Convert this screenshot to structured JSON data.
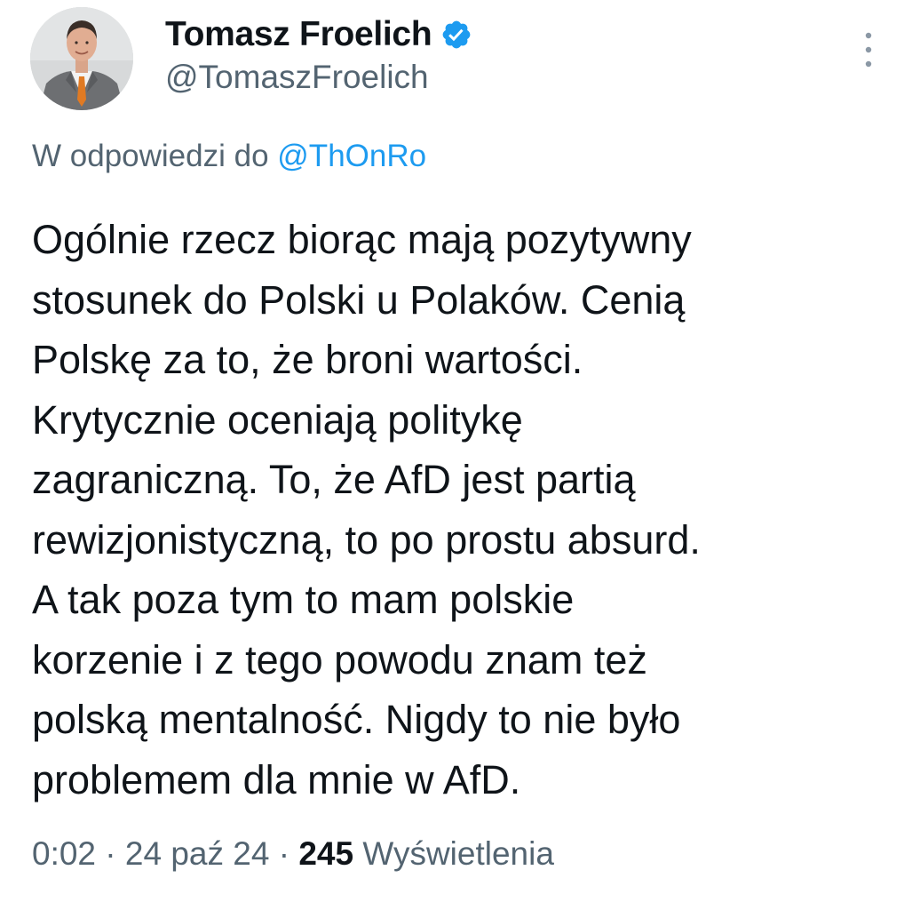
{
  "author": {
    "display_name": "Tomasz Froelich",
    "handle": "@TomaszFroelich",
    "verified": true,
    "avatar": "profile-photo"
  },
  "reply": {
    "prefix": "W odpowiedzi do",
    "mention": "@ThOnRo"
  },
  "tweet": {
    "text": "Ogólnie rzecz biorąc mają pozytywny\nstosunek do Polski u Polaków. Cenią\nPolskę za to, że broni wartości.\nKrytycznie oceniają politykę\nzagraniczną. To, że AfD jest partią\nrewizjonistyczną, to po prostu absurd.\nA tak poza tym to mam polskie\nkorzenie i z tego powodu znam też\npolską mentalność. Nigdy to nie było\nproblemem dla mnie w AfD."
  },
  "meta": {
    "time": "0:02",
    "separator": " · ",
    "date": "24 paź 24",
    "views_count": "245",
    "views_label": "Wyświetlenia"
  },
  "icons": {
    "verified": "verified-badge-icon",
    "more": "more-options-icon"
  },
  "colors": {
    "accent": "#1d9bf0",
    "text": "#0f1419",
    "secondary": "#536471"
  }
}
